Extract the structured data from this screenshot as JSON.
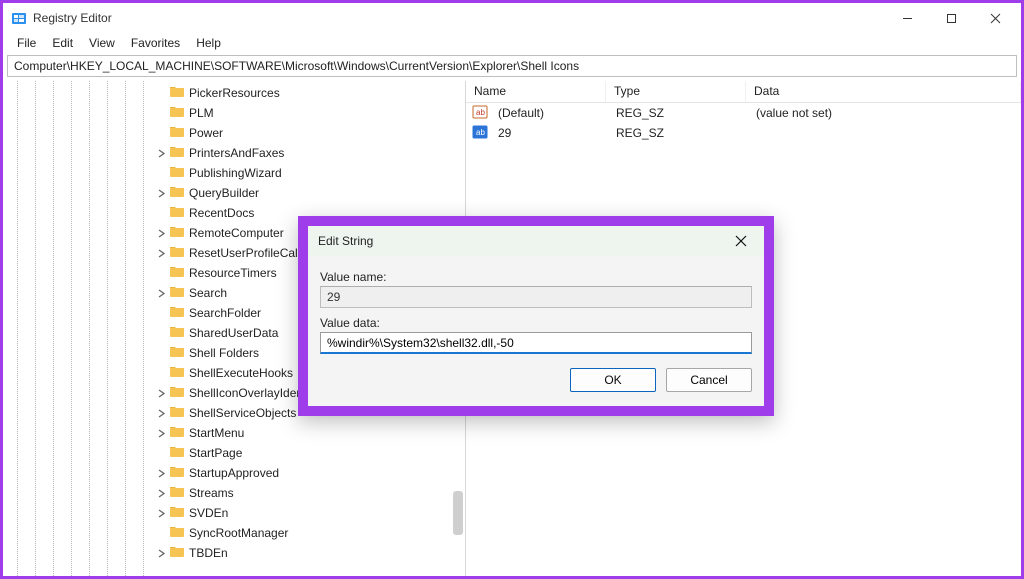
{
  "window": {
    "title": "Registry Editor"
  },
  "window_controls": {
    "minimize": "minimize",
    "maximize": "maximize",
    "close": "close"
  },
  "menubar": [
    "File",
    "Edit",
    "View",
    "Favorites",
    "Help"
  ],
  "address": "Computer\\HKEY_LOCAL_MACHINE\\SOFTWARE\\Microsoft\\Windows\\CurrentVersion\\Explorer\\Shell Icons",
  "tree": [
    {
      "label": "PickerResources",
      "expander": ""
    },
    {
      "label": "PLM",
      "expander": ""
    },
    {
      "label": "Power",
      "expander": ""
    },
    {
      "label": "PrintersAndFaxes",
      "expander": ">"
    },
    {
      "label": "PublishingWizard",
      "expander": ""
    },
    {
      "label": "QueryBuilder",
      "expander": ">"
    },
    {
      "label": "RecentDocs",
      "expander": ""
    },
    {
      "label": "RemoteComputer",
      "expander": ">"
    },
    {
      "label": "ResetUserProfileCallback",
      "expander": ">"
    },
    {
      "label": "ResourceTimers",
      "expander": ""
    },
    {
      "label": "Search",
      "expander": ">"
    },
    {
      "label": "SearchFolder",
      "expander": ""
    },
    {
      "label": "SharedUserData",
      "expander": ""
    },
    {
      "label": "Shell Folders",
      "expander": ""
    },
    {
      "label": "ShellExecuteHooks",
      "expander": ""
    },
    {
      "label": "ShellIconOverlayIdentifiers",
      "expander": ">"
    },
    {
      "label": "ShellServiceObjects",
      "expander": ">"
    },
    {
      "label": "StartMenu",
      "expander": ">"
    },
    {
      "label": "StartPage",
      "expander": ""
    },
    {
      "label": "StartupApproved",
      "expander": ">"
    },
    {
      "label": "Streams",
      "expander": ">"
    },
    {
      "label": "SVDEn",
      "expander": ">"
    },
    {
      "label": "SyncRootManager",
      "expander": ""
    },
    {
      "label": "TBDEn",
      "expander": ">"
    }
  ],
  "list": {
    "columns": {
      "name": "Name",
      "type": "Type",
      "data": "Data"
    },
    "rows": [
      {
        "name": "(Default)",
        "type": "REG_SZ",
        "data": "(value not set)",
        "icon": "string-value-icon"
      },
      {
        "name": "29",
        "type": "REG_SZ",
        "data": "",
        "icon": "string-value-icon-selected"
      }
    ]
  },
  "dialog": {
    "title": "Edit String",
    "label_name": "Value name:",
    "value_name": "29",
    "label_data": "Value data:",
    "value_data": "%windir%\\System32\\shell32.dll,-50",
    "ok": "OK",
    "cancel": "Cancel"
  }
}
